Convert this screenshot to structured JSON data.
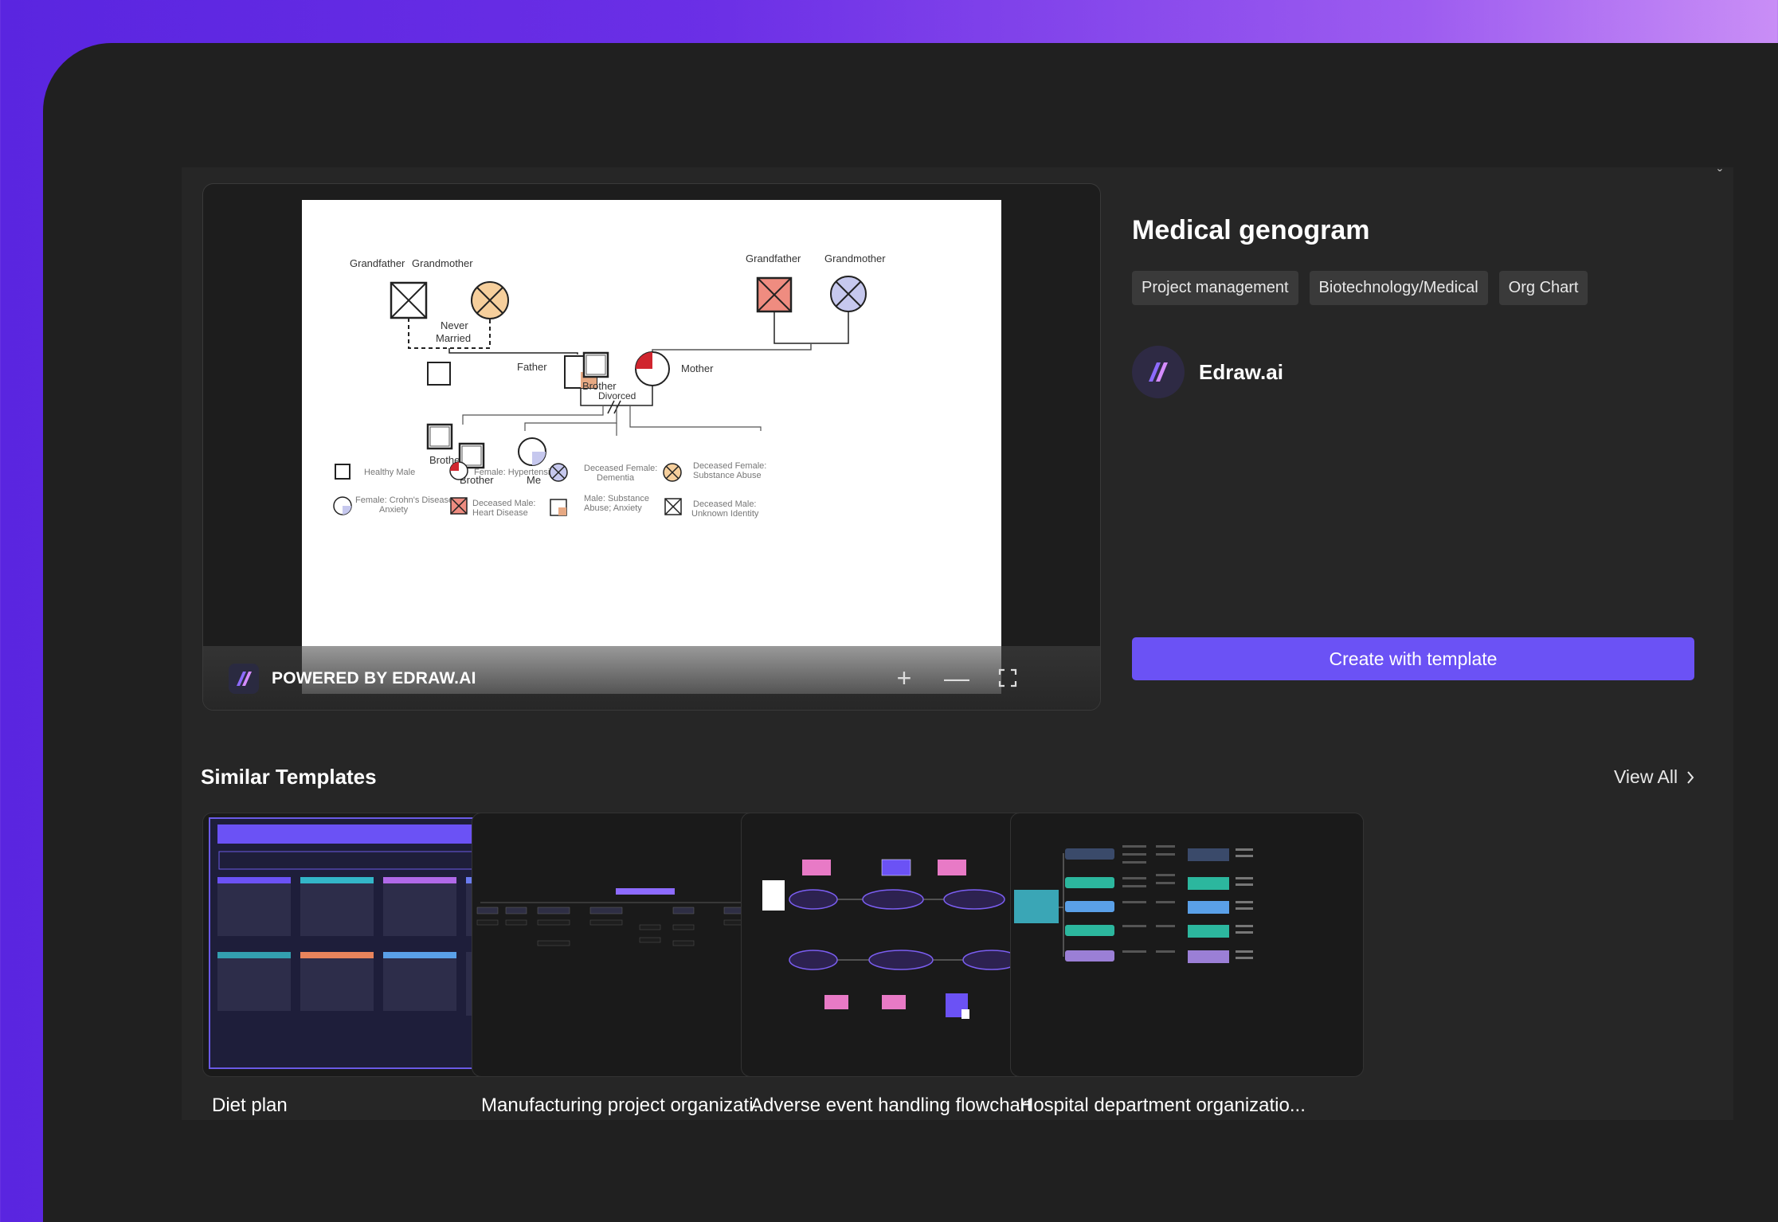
{
  "preview": {
    "powered_label": "POWERED BY EDRAW.AI",
    "zoom_in": "+",
    "zoom_out": "—",
    "fullscreen": "⤢"
  },
  "genogram": {
    "labels": {
      "grandfather_left": "Grandfather",
      "grandmother_left": "Grandmother",
      "never_married": "Never",
      "never_married_2": "Married",
      "grandfather_right": "Grandfather",
      "grandmother_right": "Grandmother",
      "father": "Father",
      "mother": "Mother",
      "divorced": "Divorced",
      "brother_1": "Brother",
      "brother_2": "Brother",
      "me": "Me",
      "brother_3": "Brother"
    },
    "legend": {
      "healthy_male": "Healthy Male",
      "female_hypertension": "Female: Hypertension",
      "deceased_female_dementia_1": "Deceased Female:",
      "deceased_female_dementia_2": "Dementia",
      "deceased_female_substance_1": "Deceased Female:",
      "deceased_female_substance_2": "Substance Abuse",
      "female_crohns_1": "Female: Crohn's Disease;",
      "female_crohns_2": "Anxiety",
      "deceased_male_heart_1": "Deceased Male:",
      "deceased_male_heart_2": "Heart Disease",
      "male_substance_1": "Male: Substance",
      "male_substance_2": "Abuse; Anxiety",
      "deceased_male_unknown_1": "Deceased Male:",
      "deceased_male_unknown_2": "Unknown Identity"
    }
  },
  "template": {
    "title": "Medical genogram",
    "tags": [
      "Project management",
      "Biotechnology/Medical",
      "Org Chart"
    ],
    "author": "Edraw.ai",
    "create_button": "Create with template"
  },
  "similar": {
    "heading": "Similar Templates",
    "view_all": "View All",
    "items": [
      {
        "label": "Diet plan"
      },
      {
        "label": "Manufacturing project organizati..."
      },
      {
        "label": "Adverse event handling flowchart"
      },
      {
        "label": "Hospital department organizatio..."
      }
    ]
  },
  "colors": {
    "accent": "#6b52f5",
    "hypertension_red": "#d0252e",
    "dementia_blue": "#c6c8ee",
    "substance_orange": "#f6cf9c",
    "heart_red": "#ef8c80"
  }
}
